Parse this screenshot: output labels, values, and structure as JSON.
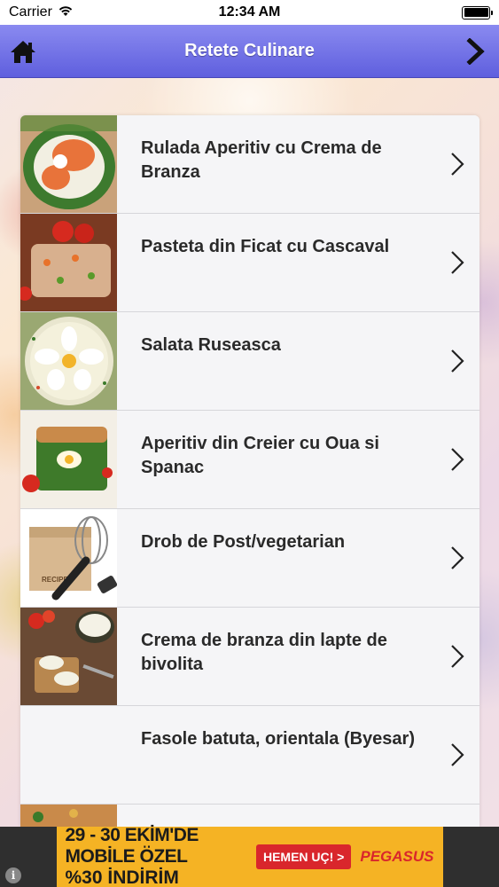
{
  "status_bar": {
    "carrier": "Carrier",
    "time": "12:34 AM",
    "icons": [
      "wifi-icon",
      "battery-icon"
    ]
  },
  "nav": {
    "title": "Retete Culinare",
    "left_icon": "home-icon",
    "right_icon": "chevron-right-icon",
    "color": "#6b6be4"
  },
  "recipes": [
    {
      "title": "Rulada Aperitiv cu Crema de Branza",
      "thumb": "rulada-thumbnail"
    },
    {
      "title": "Pasteta din Ficat cu Cascaval",
      "thumb": "pasteta-thumbnail"
    },
    {
      "title": "Salata Ruseasca",
      "thumb": "salata-thumbnail"
    },
    {
      "title": "Aperitiv din Creier cu Oua si Spanac",
      "thumb": "aperitiv-thumbnail"
    },
    {
      "title": "Drob de Post/vegetarian",
      "thumb": "recipes-whisk-thumbnail"
    },
    {
      "title": "Crema de branza din lapte de bivolita",
      "thumb": "crema-thumbnail"
    },
    {
      "title": "Fasole batuta, orientala (Byesar)",
      "thumb": ""
    },
    {
      "title": "",
      "thumb": "partial-thumbnail"
    }
  ],
  "ad": {
    "line1": "29 - 30 EKİM'DE MOBİLE ÖZEL",
    "line2": "%30 İNDİRİM",
    "cta": "HEMEN UÇ! >",
    "brand": "PEGASUS",
    "info": "i",
    "color": "#f5b324"
  }
}
